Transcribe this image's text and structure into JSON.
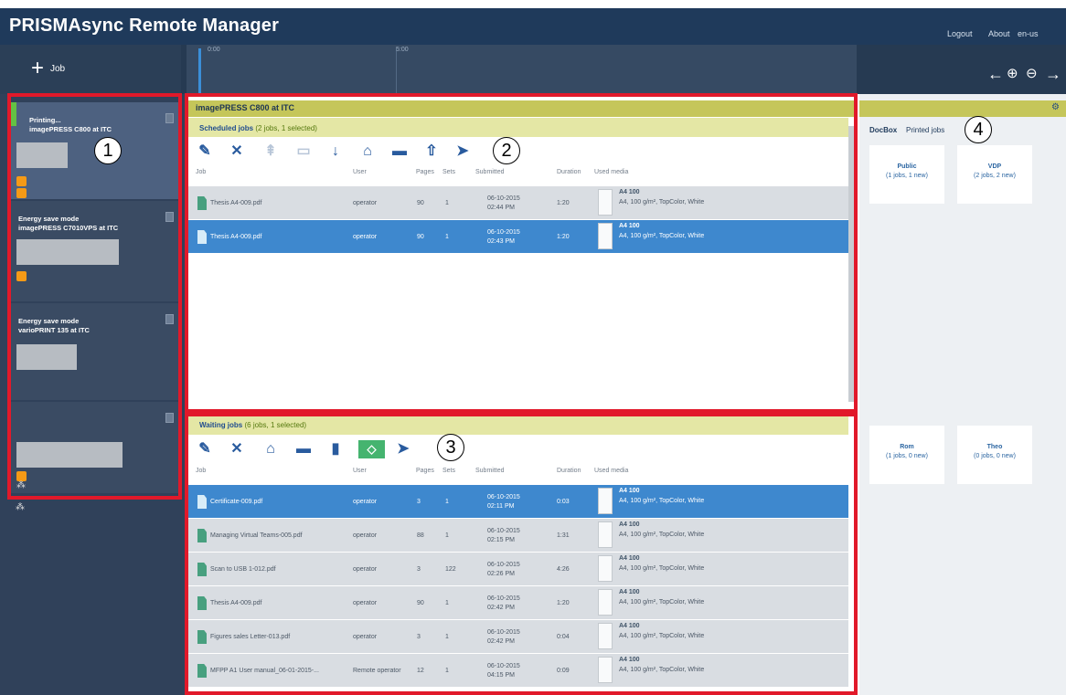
{
  "app": {
    "title": "PRISMAsync Remote Manager",
    "links": [
      "Logout",
      "About",
      "en-us"
    ]
  },
  "toolbar": {
    "add_job_label": "Job",
    "timeline_labels": [
      "0:00",
      "5:00"
    ]
  },
  "printers": [
    {
      "status": "Printing...",
      "name": "imagePRESS C800 at ITC"
    },
    {
      "status": "Energy save mode",
      "name": "imagePRESS C7010VPS at ITC"
    },
    {
      "status": "Energy save mode",
      "name": "varioPRINT 135 at ITC"
    },
    {
      "status": "",
      "name": ""
    }
  ],
  "center": {
    "printer_title": "imagePRESS C800 at ITC",
    "scheduled": {
      "title": "Scheduled jobs",
      "count": "(2 jobs, 1 selected)",
      "columns": [
        "Job",
        "User",
        "Pages",
        "Sets",
        "Submitted",
        "Duration",
        "Used media"
      ],
      "rows": [
        {
          "job": "Thesis A4-009.pdf",
          "user": "operator",
          "pages": "90",
          "sets": "1",
          "date": "06-10-2015",
          "time": "02:44 PM",
          "duration": "1:20",
          "media_title": "A4 100",
          "media": "A4, 100 g/m², TopColor, White",
          "selected": false
        },
        {
          "job": "Thesis A4-009.pdf",
          "user": "operator",
          "pages": "90",
          "sets": "1",
          "date": "06-10-2015",
          "time": "02:43 PM",
          "duration": "1:20",
          "media_title": "A4 100",
          "media": "A4, 100 g/m², TopColor, White",
          "selected": true
        }
      ]
    },
    "waiting": {
      "title": "Waiting jobs",
      "count": "(6 jobs, 1 selected)",
      "columns": [
        "Job",
        "User",
        "Pages",
        "Sets",
        "Submitted",
        "Duration",
        "Used media"
      ],
      "rows": [
        {
          "job": "Certificate-009.pdf",
          "user": "operator",
          "pages": "3",
          "sets": "1",
          "date": "06-10-2015",
          "time": "02:11 PM",
          "duration": "0:03",
          "media_title": "A4 100",
          "media": "A4, 100 g/m², TopColor, White",
          "selected": true
        },
        {
          "job": "Managing Virtual Teams-005.pdf",
          "user": "operator",
          "pages": "88",
          "sets": "1",
          "date": "06-10-2015",
          "time": "02:15 PM",
          "duration": "1:31",
          "media_title": "A4 100",
          "media": "A4, 100 g/m², TopColor, White",
          "selected": false
        },
        {
          "job": "Scan to USB 1-012.pdf",
          "user": "operator",
          "pages": "3",
          "sets": "122",
          "date": "06-10-2015",
          "time": "02:26 PM",
          "duration": "4:26",
          "media_title": "A4 100",
          "media": "A4, 100 g/m², TopColor, White",
          "selected": false
        },
        {
          "job": "Thesis A4-009.pdf",
          "user": "operator",
          "pages": "90",
          "sets": "1",
          "date": "06-10-2015",
          "time": "02:42 PM",
          "duration": "1:20",
          "media_title": "A4 100",
          "media": "A4, 100 g/m², TopColor, White",
          "selected": false
        },
        {
          "job": "Figures sales Letter-013.pdf",
          "user": "operator",
          "pages": "3",
          "sets": "1",
          "date": "06-10-2015",
          "time": "02:42 PM",
          "duration": "0:04",
          "media_title": "A4 100",
          "media": "A4, 100 g/m², TopColor, White",
          "selected": false
        },
        {
          "job": "MFPP A1 User manual_06-01-2015-...",
          "user": "Remote operator",
          "pages": "12",
          "sets": "1",
          "date": "06-10-2015",
          "time": "04:15 PM",
          "duration": "0:09",
          "media_title": "A4 100",
          "media": "A4, 100 g/m², TopColor, White",
          "selected": false
        }
      ]
    }
  },
  "docbox": {
    "tabs": [
      "DocBox",
      "Printed jobs"
    ],
    "cards": [
      {
        "title": "Public",
        "sub": "(1 jobs, 1 new)"
      },
      {
        "title": "VDP",
        "sub": "(2 jobs, 2 new)"
      },
      {
        "title": "Rom",
        "sub": "(1 jobs, 0 new)"
      },
      {
        "title": "Theo",
        "sub": "(0 jobs, 0 new)"
      }
    ]
  },
  "callouts": [
    "1",
    "2",
    "3",
    "4"
  ],
  "icons": {
    "add": "plus-icon",
    "back": "arrow-left-icon",
    "zoom_in": "zoom-in-icon",
    "zoom_out": "zoom-out-icon",
    "forward": "arrow-right-icon",
    "settings": "gear-icon"
  },
  "colors": {
    "header": "#1f3a5b",
    "selected": "#3e88ce",
    "panel_header": "#c5c65a",
    "annotation": "#e1192a",
    "alert": "#f59a16"
  }
}
